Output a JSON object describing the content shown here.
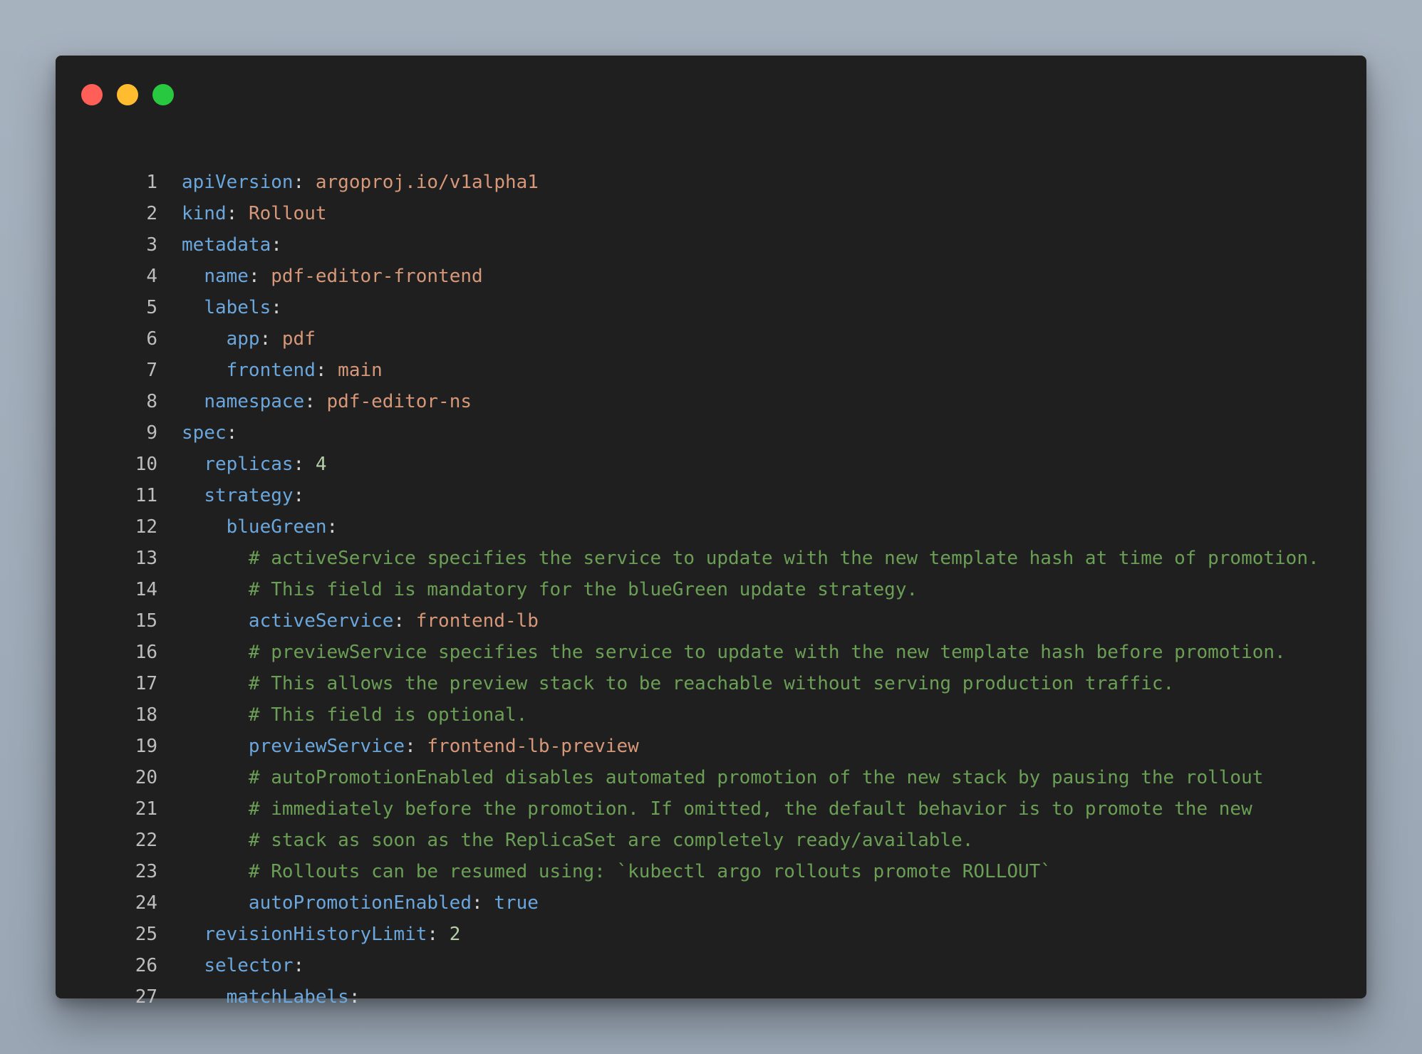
{
  "window": {
    "controls": [
      {
        "name": "close",
        "color": "#ff5f57"
      },
      {
        "name": "minimize",
        "color": "#febc2e"
      },
      {
        "name": "maximize",
        "color": "#28c840"
      }
    ]
  },
  "editor": {
    "language": "yaml",
    "lines": [
      {
        "n": "1",
        "tokens": [
          [
            "k",
            "apiVersion"
          ],
          [
            "p",
            ": "
          ],
          [
            "s",
            "argoproj.io/v1alpha1"
          ]
        ]
      },
      {
        "n": "2",
        "tokens": [
          [
            "k",
            "kind"
          ],
          [
            "p",
            ": "
          ],
          [
            "s",
            "Rollout"
          ]
        ]
      },
      {
        "n": "3",
        "tokens": [
          [
            "k",
            "metadata"
          ],
          [
            "p",
            ":"
          ]
        ]
      },
      {
        "n": "4",
        "tokens": [
          [
            "p",
            "  "
          ],
          [
            "k",
            "name"
          ],
          [
            "p",
            ": "
          ],
          [
            "s",
            "pdf-editor-frontend"
          ]
        ]
      },
      {
        "n": "5",
        "tokens": [
          [
            "p",
            "  "
          ],
          [
            "k",
            "labels"
          ],
          [
            "p",
            ":"
          ]
        ]
      },
      {
        "n": "6",
        "tokens": [
          [
            "p",
            "    "
          ],
          [
            "k",
            "app"
          ],
          [
            "p",
            ": "
          ],
          [
            "s",
            "pdf"
          ]
        ]
      },
      {
        "n": "7",
        "tokens": [
          [
            "p",
            "    "
          ],
          [
            "k",
            "frontend"
          ],
          [
            "p",
            ": "
          ],
          [
            "s",
            "main"
          ]
        ]
      },
      {
        "n": "8",
        "tokens": [
          [
            "p",
            "  "
          ],
          [
            "k",
            "namespace"
          ],
          [
            "p",
            ": "
          ],
          [
            "s",
            "pdf-editor-ns"
          ]
        ]
      },
      {
        "n": "9",
        "tokens": [
          [
            "k",
            "spec"
          ],
          [
            "p",
            ":"
          ]
        ]
      },
      {
        "n": "10",
        "tokens": [
          [
            "p",
            "  "
          ],
          [
            "k",
            "replicas"
          ],
          [
            "p",
            ": "
          ],
          [
            "n",
            "4"
          ]
        ]
      },
      {
        "n": "11",
        "tokens": [
          [
            "p",
            "  "
          ],
          [
            "k",
            "strategy"
          ],
          [
            "p",
            ":"
          ]
        ]
      },
      {
        "n": "12",
        "tokens": [
          [
            "p",
            "    "
          ],
          [
            "k",
            "blueGreen"
          ],
          [
            "p",
            ":"
          ]
        ]
      },
      {
        "n": "13",
        "tokens": [
          [
            "p",
            "      "
          ],
          [
            "c",
            "# activeService specifies the service to update with the new template hash at time of promotion."
          ]
        ]
      },
      {
        "n": "14",
        "tokens": [
          [
            "p",
            "      "
          ],
          [
            "c",
            "# This field is mandatory for the blueGreen update strategy."
          ]
        ]
      },
      {
        "n": "15",
        "tokens": [
          [
            "p",
            "      "
          ],
          [
            "k",
            "activeService"
          ],
          [
            "p",
            ": "
          ],
          [
            "s",
            "frontend-lb"
          ]
        ]
      },
      {
        "n": "16",
        "tokens": [
          [
            "p",
            "      "
          ],
          [
            "c",
            "# previewService specifies the service to update with the new template hash before promotion."
          ]
        ]
      },
      {
        "n": "17",
        "tokens": [
          [
            "p",
            "      "
          ],
          [
            "c",
            "# This allows the preview stack to be reachable without serving production traffic."
          ]
        ]
      },
      {
        "n": "18",
        "tokens": [
          [
            "p",
            "      "
          ],
          [
            "c",
            "# This field is optional."
          ]
        ]
      },
      {
        "n": "19",
        "tokens": [
          [
            "p",
            "      "
          ],
          [
            "k",
            "previewService"
          ],
          [
            "p",
            ": "
          ],
          [
            "s",
            "frontend-lb-preview"
          ]
        ]
      },
      {
        "n": "20",
        "tokens": [
          [
            "p",
            "      "
          ],
          [
            "c",
            "# autoPromotionEnabled disables automated promotion of the new stack by pausing the rollout"
          ]
        ]
      },
      {
        "n": "21",
        "tokens": [
          [
            "p",
            "      "
          ],
          [
            "c",
            "# immediately before the promotion. If omitted, the default behavior is to promote the new"
          ]
        ]
      },
      {
        "n": "22",
        "tokens": [
          [
            "p",
            "      "
          ],
          [
            "c",
            "# stack as soon as the ReplicaSet are completely ready/available."
          ]
        ]
      },
      {
        "n": "23",
        "tokens": [
          [
            "p",
            "      "
          ],
          [
            "c",
            "# Rollouts can be resumed using: `kubectl argo rollouts promote ROLLOUT`"
          ]
        ]
      },
      {
        "n": "24",
        "tokens": [
          [
            "p",
            "      "
          ],
          [
            "k",
            "autoPromotionEnabled"
          ],
          [
            "p",
            ": "
          ],
          [
            "b",
            "true"
          ]
        ]
      },
      {
        "n": "25",
        "tokens": [
          [
            "p",
            "  "
          ],
          [
            "k",
            "revisionHistoryLimit"
          ],
          [
            "p",
            ": "
          ],
          [
            "n",
            "2"
          ]
        ]
      },
      {
        "n": "26",
        "tokens": [
          [
            "p",
            "  "
          ],
          [
            "k",
            "selector"
          ],
          [
            "p",
            ":"
          ]
        ]
      },
      {
        "n": "27",
        "tokens": [
          [
            "p",
            "    "
          ],
          [
            "k",
            "matchLabels"
          ],
          [
            "p",
            ":"
          ]
        ]
      }
    ]
  }
}
